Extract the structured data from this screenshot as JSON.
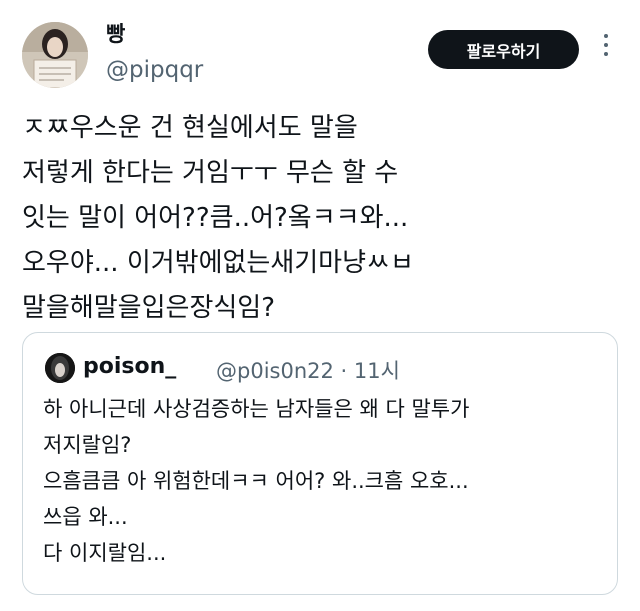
{
  "author": {
    "name": "빵",
    "handle": "@pipqqr"
  },
  "follow_button": {
    "label": "팔로우하기"
  },
  "icons": {
    "more": "more-vertical-icon"
  },
  "tweet": {
    "lines": [
      "ㅈㅉ우스운 건 현실에서도 말을",
      "저렇게 한다는 거임ㅜㅜ 무슨 할 수",
      "잇는 말이 어어??큼..어?옼ㅋㅋ와...",
      "오우야... 이거밖에없는새기마냥ㅆㅂ",
      "말을해말을입은장식임?"
    ]
  },
  "quoted_tweet": {
    "name": "poison_",
    "handle_time": "@p0is0n22 · 11시",
    "lines": [
      "하 아니근데 사상검증하는 남자들은 왜 다 말투가",
      "저지랄임?",
      "으흠큼큼 아 위험한데ㅋㅋ 어어? 와..크흠 오호...",
      "쓰읍 와...",
      "다 이지랄임..."
    ]
  }
}
